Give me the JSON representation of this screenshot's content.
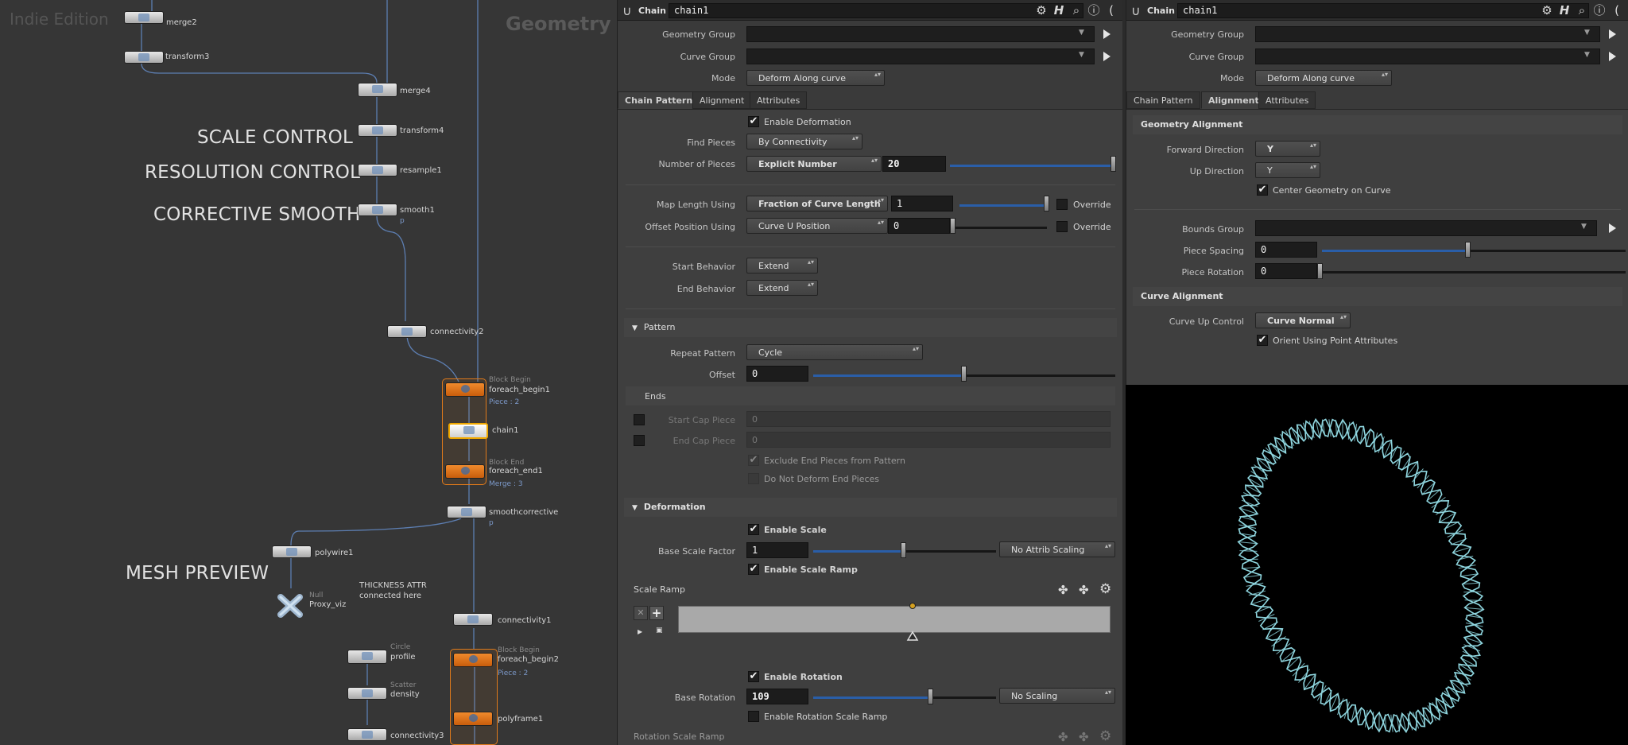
{
  "network": {
    "watermark": "Indie Edition",
    "context": "Geometry",
    "annotations": {
      "scale": "SCALE CONTROL",
      "resolution": "RESOLUTION CONTROL",
      "smooth": "CORRECTIVE SMOOTH",
      "mesh": "MESH PREVIEW",
      "thickness1": "THICKNESS ATTR",
      "thickness2": "connected here"
    },
    "nodes": {
      "merge2": "merge2",
      "transform3": "transform3",
      "merge4": "merge4",
      "transform4": "transform4",
      "resample1": "resample1",
      "smooth1": "smooth1",
      "smooth1_flag": "p",
      "connectivity2": "connectivity2",
      "foreach_begin1_tag": "Block Begin",
      "foreach_begin1": "foreach_begin1",
      "foreach_begin1_sub": "Piece : 2",
      "chain1": "chain1",
      "foreach_end1_tag": "Block End",
      "foreach_end1": "foreach_end1",
      "foreach_end1_sub": "Merge : 3",
      "smoothcorrective": "smoothcorrective",
      "smoothcorrective_flag": "p",
      "polywire1": "polywire1",
      "null_tag": "Null",
      "proxy_viz": "Proxy_viz",
      "connectivity1": "connectivity1",
      "circle_tag": "Circle",
      "profile": "profile",
      "scatter_tag": "Scatter",
      "density": "density",
      "foreach_begin2_tag": "Block Begin",
      "foreach_begin2": "foreach_begin2",
      "foreach_begin2_sub": "Piece : 2",
      "polyframe1": "polyframe1",
      "connectivity3": "connectivity3"
    }
  },
  "params1": {
    "node_type": "Chain",
    "node_name": "chain1",
    "geometry_group_label": "Geometry Group",
    "geometry_group_value": "",
    "curve_group_label": "Curve Group",
    "curve_group_value": "",
    "mode_label": "Mode",
    "mode_value": "Deform Along curve",
    "tabs": [
      "Chain Pattern",
      "Alignment",
      "Attributes"
    ],
    "enable_deformation": "Enable Deformation",
    "find_pieces_label": "Find Pieces",
    "find_pieces_value": "By Connectivity",
    "num_pieces_label": "Number of Pieces",
    "num_pieces_mode": "Explicit Number",
    "num_pieces_value": "20",
    "map_length_label": "Map Length Using",
    "map_length_mode": "Fraction of Curve Length",
    "map_length_value": "1",
    "override": "Override",
    "offset_pos_label": "Offset Position Using",
    "offset_pos_mode": "Curve U Position",
    "offset_pos_value": "0",
    "start_behavior_label": "Start Behavior",
    "start_behavior_value": "Extend",
    "end_behavior_label": "End Behavior",
    "end_behavior_value": "Extend",
    "pattern_folder": "Pattern",
    "repeat_pattern_label": "Repeat Pattern",
    "repeat_pattern_value": "Cycle",
    "offset_label": "Offset",
    "offset_value": "0",
    "ends_label": "Ends",
    "start_cap_label": "Start Cap Piece",
    "start_cap_value": "0",
    "end_cap_label": "End Cap Piece",
    "end_cap_value": "0",
    "exclude_end": "Exclude End Pieces from Pattern",
    "no_deform_end": "Do Not Deform End Pieces",
    "deformation_folder": "Deformation",
    "enable_scale": "Enable Scale",
    "base_scale_label": "Base Scale Factor",
    "base_scale_value": "1",
    "attrib_scaling": "No Attrib Scaling",
    "enable_scale_ramp": "Enable Scale Ramp",
    "scale_ramp_label": "Scale Ramp",
    "enable_rotation": "Enable Rotation",
    "base_rotation_label": "Base Rotation",
    "base_rotation_value": "109",
    "rotation_scaling": "No Scaling",
    "enable_rot_ramp": "Enable Rotation Scale Ramp",
    "rot_ramp_label": "Rotation Scale Ramp"
  },
  "params2": {
    "node_type": "Chain",
    "node_name": "chain1",
    "geometry_group_label": "Geometry Group",
    "curve_group_label": "Curve Group",
    "mode_label": "Mode",
    "mode_value": "Deform Along curve",
    "tabs": [
      "Chain Pattern",
      "Alignment",
      "Attributes"
    ],
    "geo_align_header": "Geometry Alignment",
    "forward_dir_label": "Forward Direction",
    "forward_dir_value": "Y",
    "up_dir_label": "Up Direction",
    "up_dir_value": "Y",
    "center_geo": "Center Geometry on Curve",
    "bounds_group_label": "Bounds Group",
    "piece_spacing_label": "Piece Spacing",
    "piece_spacing_value": "0",
    "piece_rotation_label": "Piece Rotation",
    "piece_rotation_value": "0",
    "curve_align_header": "Curve Alignment",
    "curve_up_label": "Curve Up Control",
    "curve_up_value": "Curve Normal",
    "orient_point": "Orient Using Point Attributes"
  },
  "colors": {
    "accent_blue": "#2a5ea8",
    "block_orange": "#e07a1a",
    "wire_blue": "#5d7fb3",
    "chain_cyan": "#8fd6df"
  }
}
